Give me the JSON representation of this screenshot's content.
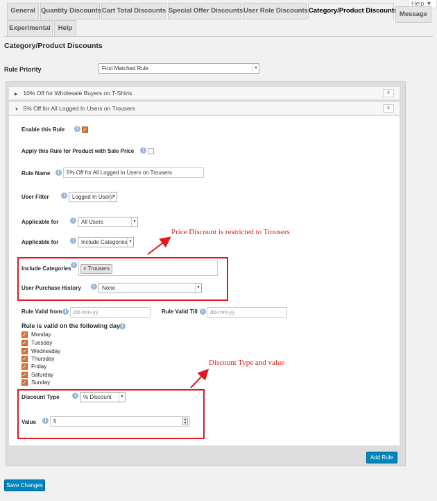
{
  "help_tab": {
    "label": "Help ▼"
  },
  "tabs": [
    {
      "label": "General"
    },
    {
      "label": "Quantity Discounts"
    },
    {
      "label": "Cart Total Discounts"
    },
    {
      "label": "Special Offer Discounts"
    },
    {
      "label": "User Role Discounts"
    },
    {
      "label": "Category/Product Discounts"
    },
    {
      "label": "Message"
    },
    {
      "label": "Experimental"
    },
    {
      "label": "Help"
    }
  ],
  "page_title": "Category/Product Discounts",
  "rule_priority": {
    "label": "Rule Priority",
    "value": "First Matched Rule"
  },
  "rules": [
    {
      "title": "10% Off for Wholesale Buyers on T-Shirts",
      "remove": "x"
    },
    {
      "title": "5% Off for All Logged In Users on Trousers",
      "remove": "x"
    }
  ],
  "form": {
    "enable_label": "Enable this Rule",
    "sale_label": "Apply this Rule for Product with Sale Price",
    "name_label": "Rule Name",
    "name_value": "5% Off for All Logged In Users on Trousers",
    "user_filter_label": "User Filter",
    "user_filter_value": "Logged In Users",
    "applicable_label": "Applicable for",
    "applicable_value": "All Users",
    "applicable2_label": "Applicable for",
    "applicable2_value": "Include Categories",
    "include_label": "Include Categories",
    "include_tag": "× Trousers",
    "history_label": "User Purchase History",
    "history_value": "None",
    "valid_from_label": "Rule Valid from",
    "valid_from_ph": "dd-mm-yy",
    "valid_till_label": "Rule Valid Till",
    "valid_till_ph": "dd-mm-yy",
    "days_label": "Rule is valid on the following days",
    "days": [
      "Monday",
      "Tuesday",
      "Wednesday",
      "Thursday",
      "Friday",
      "Saturday",
      "Sunday"
    ],
    "discount_type_label": "Discount Type",
    "discount_type_value": "% Discount",
    "value_label": "Value",
    "value_value": "5"
  },
  "annotations": {
    "a1": "Price Discount is restricted to Trousers",
    "a2": "Discount Type and value"
  },
  "buttons": {
    "add_rule": "Add Rule",
    "save": "Save Changes"
  },
  "colors": {
    "accent": "#0085ba",
    "annotation": "#e3171d",
    "checkbox": "#d4733d"
  }
}
